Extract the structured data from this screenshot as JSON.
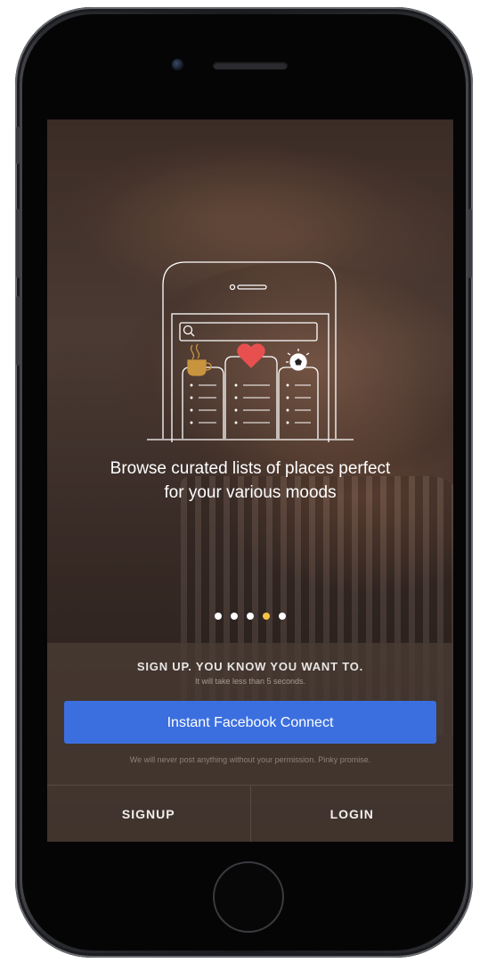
{
  "onboarding": {
    "tagline_line1": "Browse curated lists of places perfect",
    "tagline_line2": "for your various moods",
    "page_count": 5,
    "active_page": 4
  },
  "signup_panel": {
    "headline": "SIGN UP. YOU KNOW YOU WANT TO.",
    "subline": "It will take less than 5 seconds.",
    "facebook_button_label": "Instant Facebook Connect",
    "disclaimer": "We will never post anything without your permission. Pinky promise."
  },
  "bottom_tabs": {
    "signup_label": "SIGNUP",
    "login_label": "LOGIN"
  },
  "colors": {
    "accent_blue": "#3b6fe0",
    "active_dot": "#f6c344",
    "heart": "#e8504f",
    "coffee": "#c9943e"
  },
  "icons": [
    "search-icon",
    "coffee-cup-icon",
    "heart-icon",
    "soccer-ball-icon"
  ]
}
